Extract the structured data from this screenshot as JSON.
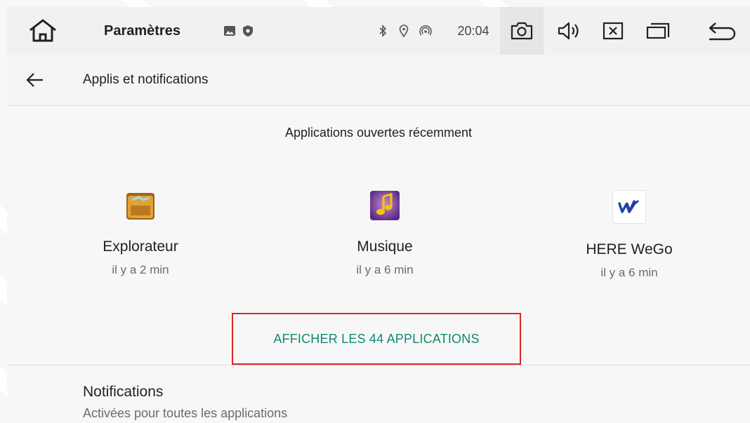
{
  "statusbar": {
    "title": "Paramètres",
    "time": "20:04",
    "icons": [
      "home-icon",
      "image-icon",
      "shield-icon",
      "bluetooth-icon",
      "location-icon",
      "hotspot-icon",
      "camera-icon",
      "volume-icon",
      "close-box-icon",
      "recent-apps-icon",
      "back-icon"
    ]
  },
  "appbar": {
    "title": "Applis et notifications"
  },
  "recent": {
    "title": "Applications ouvertes récemment",
    "apps": [
      {
        "name": "Explorateur",
        "time": "il y a 2 min"
      },
      {
        "name": "Musique",
        "time": "il y a 6 min"
      },
      {
        "name": "HERE WeGo",
        "time": "il y a 6 min"
      }
    ],
    "show_all": "AFFICHER LES 44 APPLICATIONS"
  },
  "notifications": {
    "title": "Notifications",
    "subtitle": "Activées pour toutes les applications"
  },
  "colors": {
    "accent": "#0f8a72",
    "highlight_box": "#e02424"
  }
}
